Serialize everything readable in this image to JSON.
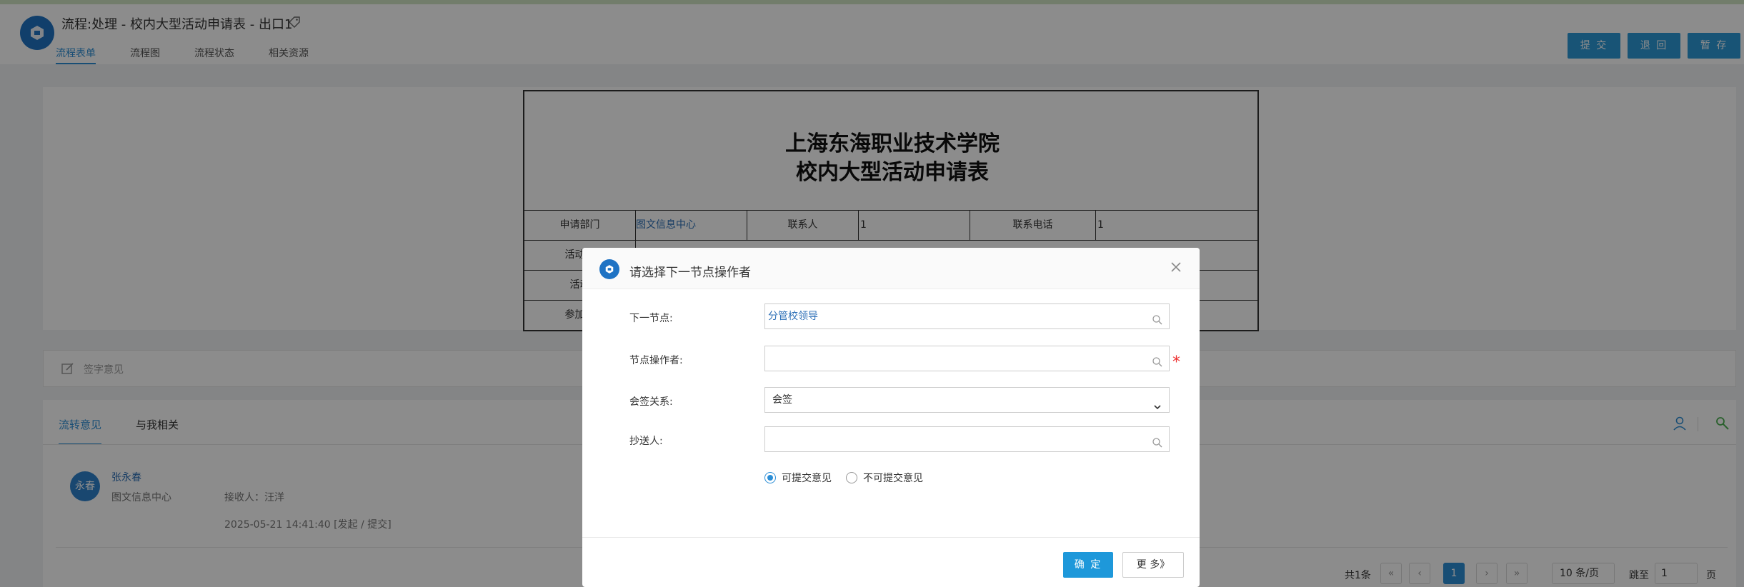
{
  "header": {
    "title": "流程:处理 - 校内大型活动申请表 - 出口1",
    "tabs": [
      "流程表单",
      "流程图",
      "流程状态",
      "相关资源"
    ],
    "buttons": {
      "submit": "提 交",
      "return": "退 回",
      "save": "暂 存"
    }
  },
  "form": {
    "title_line1": "上海东海职业技术学院",
    "title_line2": "校内大型活动申请表",
    "row1": {
      "dept_label": "申请部门",
      "dept_value": "图文信息中心",
      "contact_label": "联系人",
      "contact_value": "1",
      "phone_label": "联系电话",
      "phone_value": "1"
    },
    "row2_label": "活动开",
    "row3_label": "活动",
    "row4_label": "参加人"
  },
  "sign": {
    "placeholder": "签字意见"
  },
  "opinions": {
    "tabs": [
      "流转意见",
      "与我相关"
    ],
    "entry": {
      "avatar": "永春",
      "name": "张永春",
      "dept": "图文信息中心",
      "receiver": "接收人：汪洋",
      "time": "2025-05-21 14:41:40   [发起 / 提交]"
    }
  },
  "pager": {
    "total": "共1条",
    "current": "1",
    "page_size": "10 条/页",
    "jump_label": "跳至",
    "jump_value": "1",
    "page_unit": "页"
  },
  "dialog": {
    "title": "请选择下一节点操作者",
    "next_node_label": "下一节点:",
    "next_node_value": "分管校领导",
    "operator_label": "节点操作者:",
    "operator_value": "",
    "relation_label": "会签关系:",
    "relation_value": "会签",
    "cc_label": "抄送人:",
    "cc_value": "",
    "radio_yes": "可提交意见",
    "radio_no": "不可提交意见",
    "ok": "确 定",
    "more": "更 多》",
    "required_mark": "*"
  },
  "colors": {
    "accent": "#2c8ed6",
    "button": "#2d9ad7",
    "required": "#ee3333"
  }
}
